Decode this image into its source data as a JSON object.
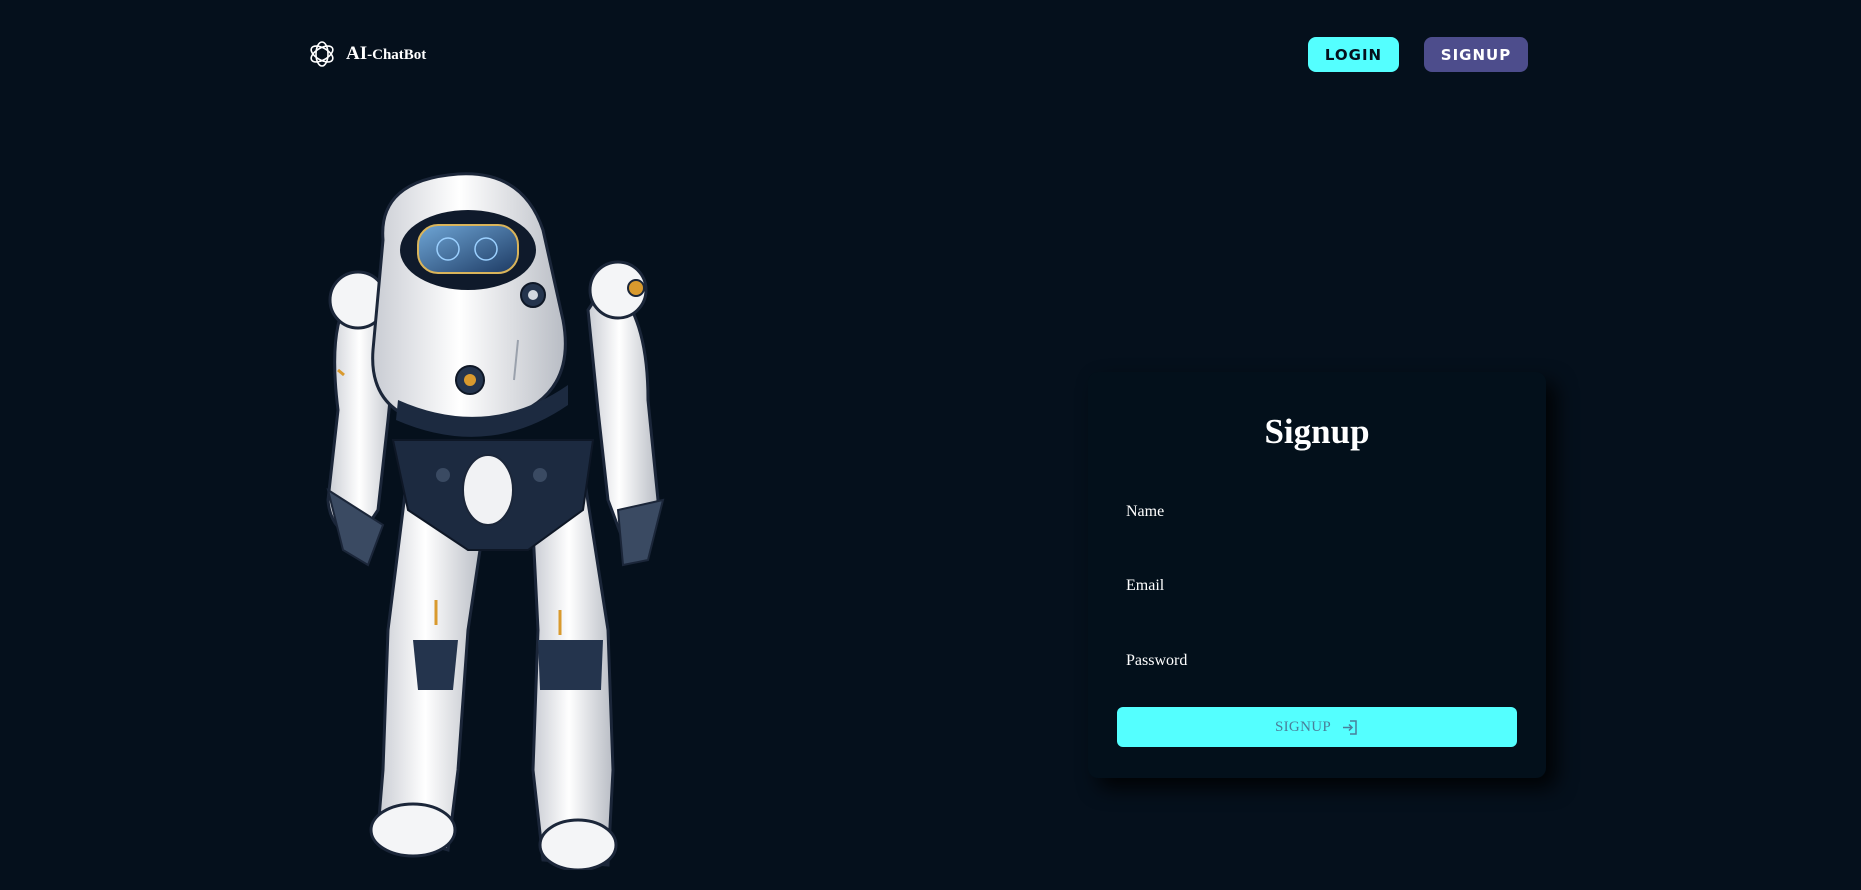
{
  "header": {
    "logo_main": "AI",
    "logo_sub": "-ChatBot",
    "login_label": "LOGIN",
    "signup_label": "SIGNUP"
  },
  "form": {
    "title": "Signup",
    "fields": [
      {
        "label": "Name",
        "value": ""
      },
      {
        "label": "Email",
        "value": ""
      },
      {
        "label": "Password",
        "value": ""
      }
    ],
    "submit_label": "SIGNUP",
    "submit_icon": "login-icon"
  },
  "colors": {
    "background": "#05101c",
    "card_background": "#03101b",
    "accent_cyan": "#54ffff",
    "nav_signup_bg": "#4d4d8c",
    "submit_text": "#4a7f9a"
  },
  "icons": {
    "logo": "openai-logo-icon",
    "submit": "login-icon"
  }
}
